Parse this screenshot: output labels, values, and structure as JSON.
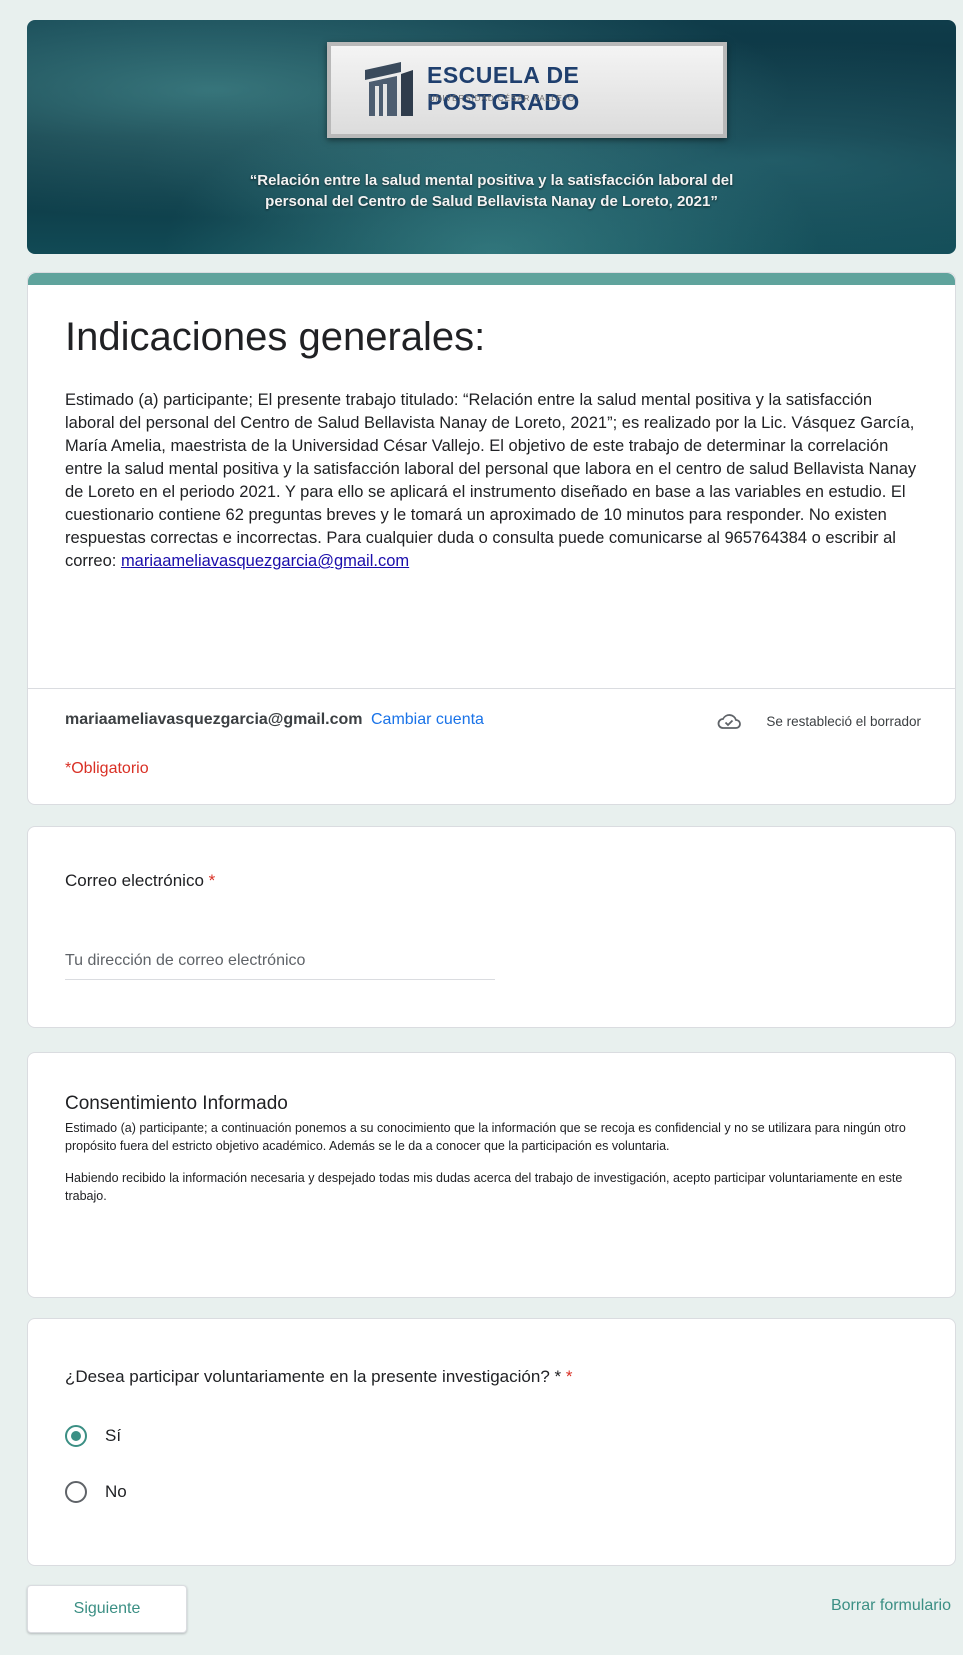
{
  "banner": {
    "logo_title": "ESCUELA DE POSTGRADO",
    "logo_subtitle": "UNIVERSIDAD CÉSAR VALLEJO",
    "caption_line1": "“Relación entre la salud mental positiva y la satisfacción laboral del",
    "caption_line2": "personal del Centro de Salud Bellavista Nanay de Loreto, 2021”"
  },
  "header": {
    "title": "Indicaciones generales:",
    "description": "Estimado (a) participante; El presente trabajo titulado: “Relación entre la salud mental positiva y la satisfacción laboral del personal del Centro de Salud Bellavista Nanay de Loreto, 2021”; es realizado por la Lic. Vásquez García, María Amelia, maestrista de la Universidad César Vallejo. El objetivo de este trabajo de determinar la correlación entre la salud mental positiva y la satisfacción laboral del personal que labora en el centro de salud Bellavista Nanay de Loreto en el periodo 2021. Y para ello se aplicará el instrumento diseñado en base a las variables en estudio. El cuestionario contiene 62 preguntas breves y le tomará un aproximado de 10 minutos para responder. No existen respuestas correctas e incorrectas. Para cualquier duda o consulta puede comunicarse al 965764384 o escribir al correo: ",
    "contact_email": "mariaameliavasquezgarcia@gmail.com",
    "account_email": "mariaameliavasquezgarcia@gmail.com",
    "switch_account": "Cambiar cuenta",
    "draft_status": "Se restableció el borrador",
    "required_note": "*Obligatorio"
  },
  "email_question": {
    "label": "Correo electrónico",
    "required_mark": "*",
    "placeholder": "Tu dirección de correo electrónico"
  },
  "consent": {
    "title": "Consentimiento Informado",
    "paragraph1": "Estimado (a) participante; a continuación ponemos a su conocimiento que la información que se recoja es confidencial y no se utilizara para ningún otro propósito fuera del estricto objetivo académico. Además se le da a conocer que la participación es voluntaria.",
    "paragraph2": "Habiendo recibido la información necesaria y despejado todas mis dudas acerca del trabajo de investigación, acepto participar voluntariamente en este trabajo."
  },
  "participation_question": {
    "label": "¿Desea participar voluntariamente en la presente investigación? *",
    "required_mark": "*",
    "options": [
      {
        "label": "Sí",
        "selected": true
      },
      {
        "label": "No",
        "selected": false
      }
    ]
  },
  "footer": {
    "next_label": "Siguiente",
    "clear_label": "Borrar formulario"
  },
  "colors": {
    "accent": "#5fa39c",
    "required": "#d93025",
    "link": "#1a73e8"
  }
}
